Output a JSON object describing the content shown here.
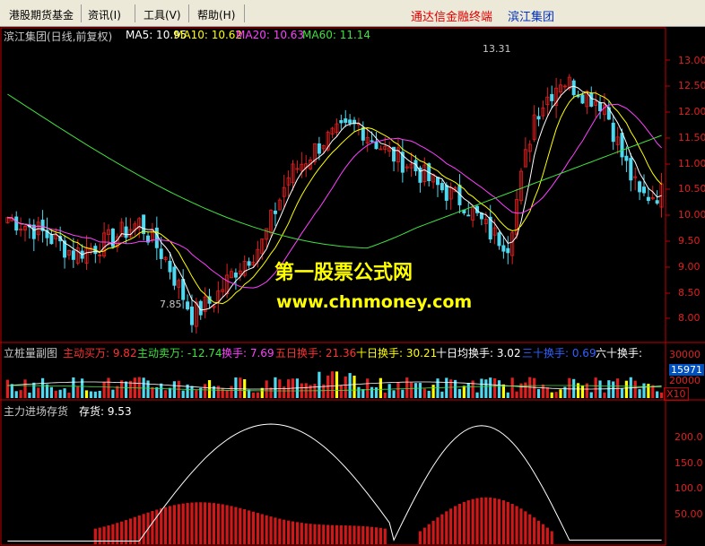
{
  "menu": {
    "items": [
      {
        "label": "港股期货基金"
      },
      {
        "label": "资讯(",
        "hotkey": "I",
        ")": ")"
      },
      {
        "label": "工具(",
        "hotkey": "V"
      },
      {
        "label": "帮助(",
        "hotkey": "H"
      }
    ],
    "items_text": [
      "港股期货基金",
      "资讯(I)",
      "工具(V)",
      "帮助(H)"
    ],
    "brand_red": "通达信金融终端",
    "brand_blue": "滨江集团"
  },
  "main_chart": {
    "title": "滨江集团(日线,前复权)",
    "ma5": "MA5: 10.95",
    "ma10": "MA10: 10.62",
    "ma20": "MA20: 10.63",
    "ma60": "MA60: 11.14",
    "high_label": "13.31",
    "low_label": "7.85",
    "y_ticks": [
      "13.00",
      "12.50",
      "12.00",
      "11.50",
      "11.00",
      "10.50",
      "10.00",
      "9.50",
      "9.00",
      "8.50",
      "8.00"
    ],
    "watermark_cn": "第一股票公式网",
    "watermark_en": "www.chnmoney.com"
  },
  "volume_panel": {
    "title": "立桩量副图",
    "buy": "主动买万: 9.82",
    "sell": "主动卖万: -12.74",
    "turnover": "换手: 7.69",
    "turnover5": "五日换手: 21.36",
    "turnover10": "十日换手: 30.21",
    "avg": "十日均换手: 3.02",
    "turnover30": "三十换手: 0.69",
    "turnover60": "六十换手:",
    "y_ticks": [
      "30000",
      "20000"
    ],
    "last_value": "15971",
    "unit": "X10"
  },
  "inventory_panel": {
    "title": "主力进场存货",
    "value": "存货: 9.53",
    "y_ticks": [
      "200.0",
      "150.0",
      "100.0",
      "50.00"
    ]
  },
  "colors": {
    "up": "#e02020",
    "down": "#4fd8f0",
    "ma5": "#ffffff",
    "ma10": "#ffff00",
    "ma20": "#ff40ff",
    "ma60": "#40e040",
    "axis": "#c00000"
  },
  "chart_data": {
    "type": "candlestick",
    "price_range": [
      7.6,
      13.5
    ],
    "ma_values": {
      "MA5": 10.95,
      "MA10": 10.62,
      "MA20": 10.63,
      "MA60": 11.14
    },
    "high": 13.31,
    "low": 7.85
  }
}
